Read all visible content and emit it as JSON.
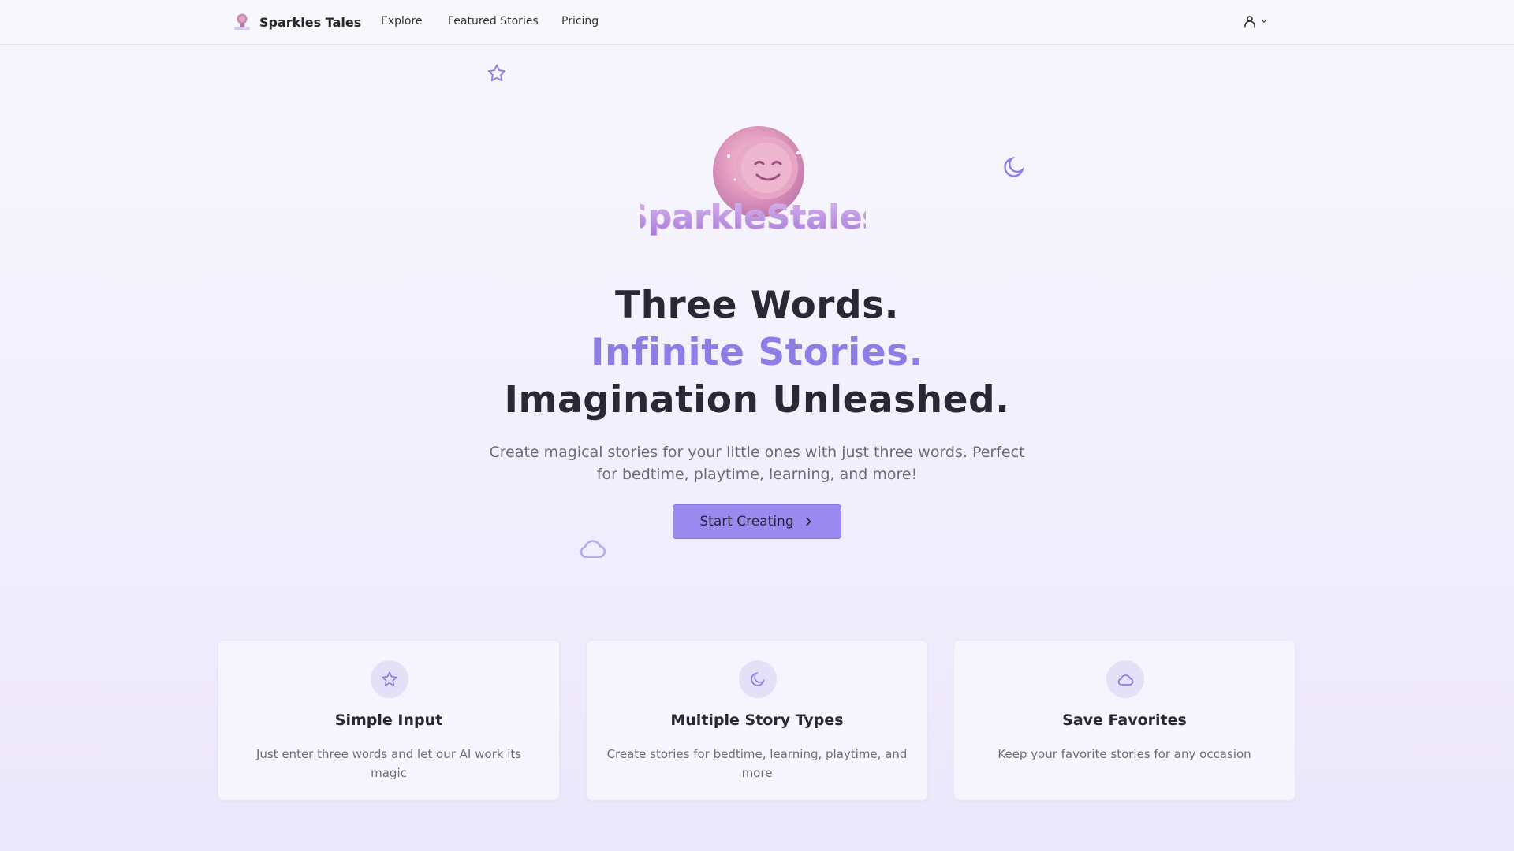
{
  "nav": {
    "brand": "Sparkles Tales",
    "links": [
      "Explore",
      "Featured Stories",
      "Pricing"
    ]
  },
  "hero": {
    "logo_text": "SparkleStales",
    "line1": "Three Words.",
    "line2": "Infinite Stories.",
    "line3": "Imagination Unleashed.",
    "subtitle": "Create magical stories for your little ones with just three words. Perfect for bedtime, playtime, learning, and more!",
    "cta_label": "Start Creating"
  },
  "features": [
    {
      "icon": "star-icon",
      "title": "Simple Input",
      "text": "Just enter three words and let our AI work its magic"
    },
    {
      "icon": "moon-icon",
      "title": "Multiple Story Types",
      "text": "Create stories for bedtime, learning, playtime, and more"
    },
    {
      "icon": "cloud-icon",
      "title": "Save Favorites",
      "text": "Keep your favorite stories for any occasion"
    }
  ],
  "colors": {
    "accent": "#9a8af0",
    "accent_text": "#8f7de6",
    "heading": "#2b2833",
    "muted": "#6e6b7b"
  }
}
